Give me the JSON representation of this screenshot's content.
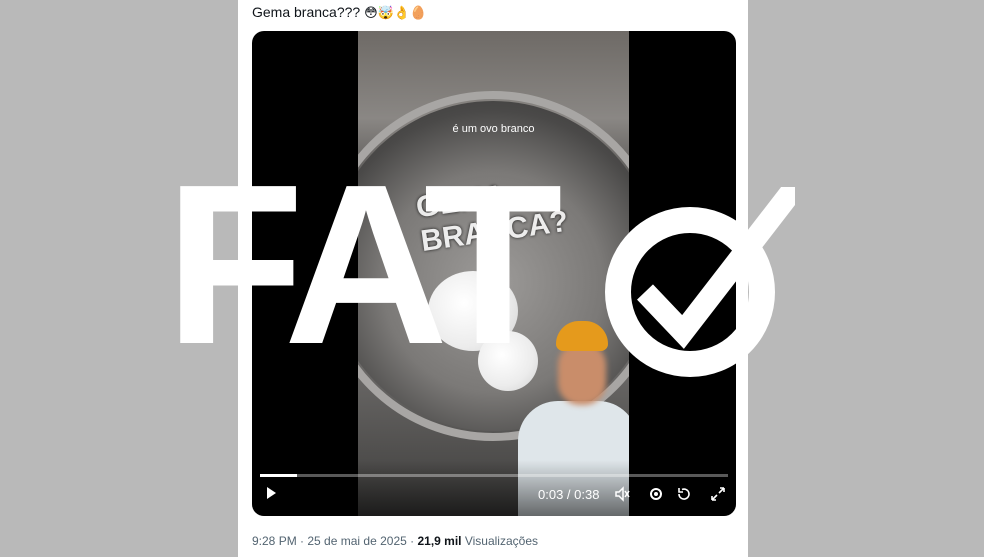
{
  "post": {
    "text": "Gema branca???",
    "emojis": "😳🤯👌🥚"
  },
  "video": {
    "overlay_caption": "é um ovo branco",
    "sticker_text_line1": "GEMA",
    "sticker_text_line2": "BRANCA?",
    "timeline": "0:03 / 0:38",
    "progress": 0.08
  },
  "meta": {
    "time": "9:28 PM",
    "separator": " · ",
    "date": "25 de mai de 2025",
    "views_count": "21,9 mil",
    "views_label": "Visualizações"
  },
  "stamp": {
    "text": "FAT"
  }
}
